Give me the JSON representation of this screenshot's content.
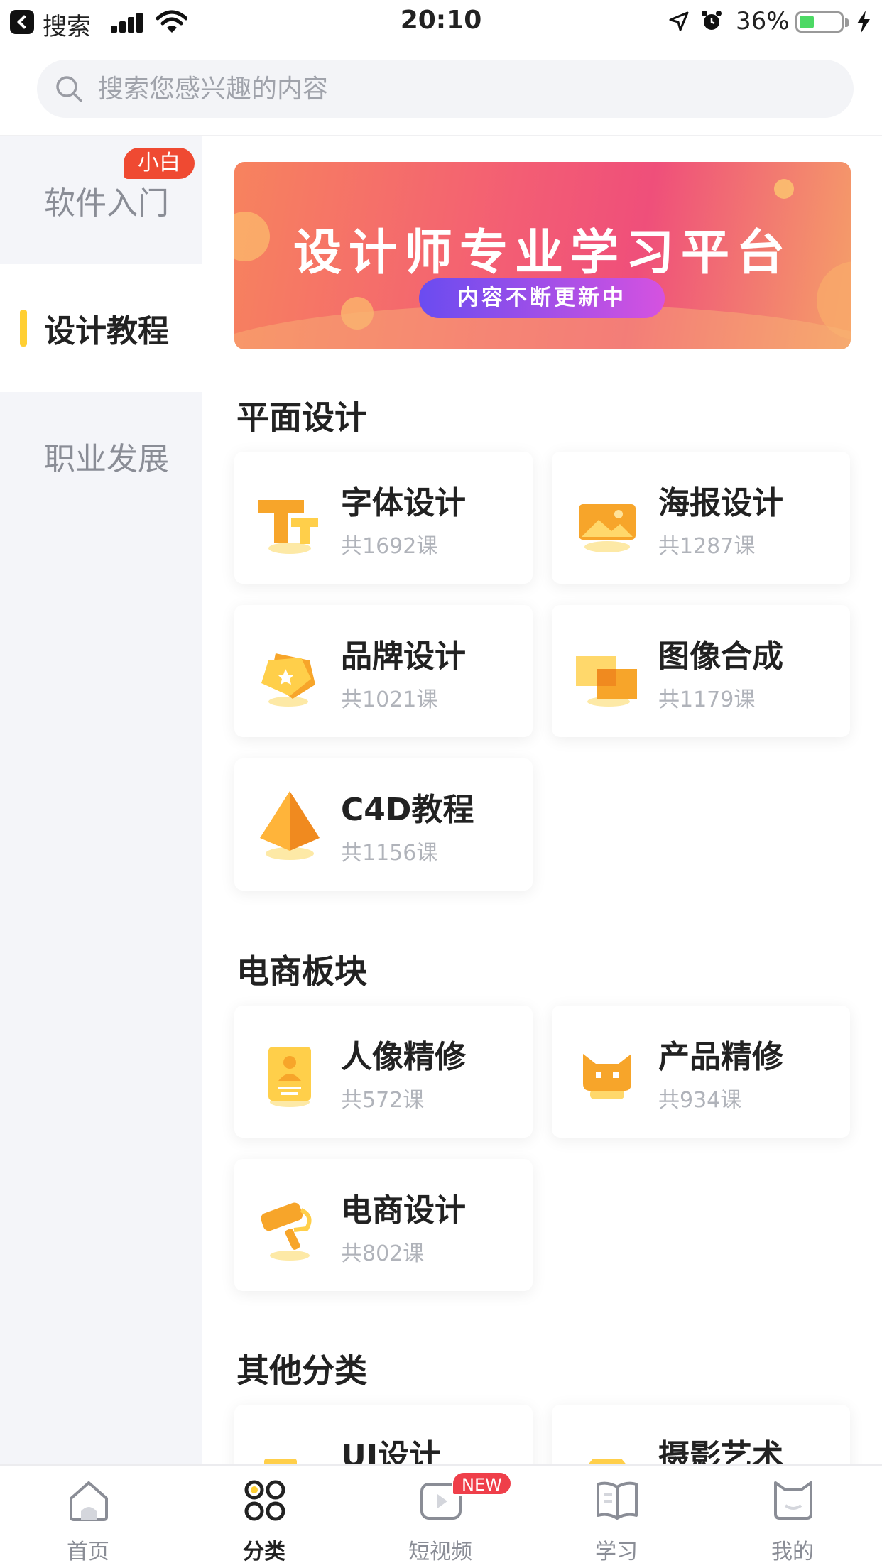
{
  "status_bar": {
    "back_app": "搜索",
    "time": "20:10",
    "battery_percent": "36%",
    "battery_level": 0.36,
    "icons": [
      "back-icon",
      "signal-icon",
      "wifi-icon",
      "location-icon",
      "alarm-icon",
      "battery-icon",
      "charging-icon"
    ]
  },
  "search": {
    "placeholder": "搜索您感兴趣的内容"
  },
  "sidebar": {
    "items": [
      {
        "label": "软件入门",
        "badge": "小白"
      },
      {
        "label": "设计教程"
      },
      {
        "label": "职业发展"
      }
    ],
    "active_index": 1
  },
  "banner": {
    "title": "设计师专业学习平台",
    "pill": "内容不断更新中"
  },
  "sections": [
    {
      "title": "平面设计",
      "cards": [
        {
          "title": "字体设计",
          "count": "共1692课",
          "icon": "font-icon"
        },
        {
          "title": "海报设计",
          "count": "共1287课",
          "icon": "image-icon"
        },
        {
          "title": "品牌设计",
          "count": "共1021课",
          "icon": "brand-tag-icon"
        },
        {
          "title": "图像合成",
          "count": "共1179课",
          "icon": "layers-icon"
        },
        {
          "title": "C4D教程",
          "count": "共1156课",
          "icon": "pyramid-icon"
        }
      ]
    },
    {
      "title": "电商板块",
      "cards": [
        {
          "title": "人像精修",
          "count": "共572课",
          "icon": "portrait-icon"
        },
        {
          "title": "产品精修",
          "count": "共934课",
          "icon": "product-icon"
        },
        {
          "title": "电商设计",
          "count": "共802课",
          "icon": "paint-roller-icon"
        }
      ]
    },
    {
      "title": "其他分类",
      "cards": [
        {
          "title": "UI设计",
          "count": "",
          "icon": "ui-icon"
        },
        {
          "title": "摄影艺术",
          "count": "",
          "icon": "camera-icon"
        }
      ]
    }
  ],
  "tabbar": {
    "items": [
      {
        "label": "首页",
        "icon": "home-icon"
      },
      {
        "label": "分类",
        "icon": "category-icon"
      },
      {
        "label": "短视频",
        "icon": "video-icon",
        "badge": "NEW"
      },
      {
        "label": "学习",
        "icon": "book-icon"
      },
      {
        "label": "我的",
        "icon": "profile-icon"
      }
    ],
    "active_index": 1
  },
  "colors": {
    "accent_yellow": "#ffcf33",
    "badge_red": "#ef4a32",
    "icon_orange": "#f7a52a"
  }
}
